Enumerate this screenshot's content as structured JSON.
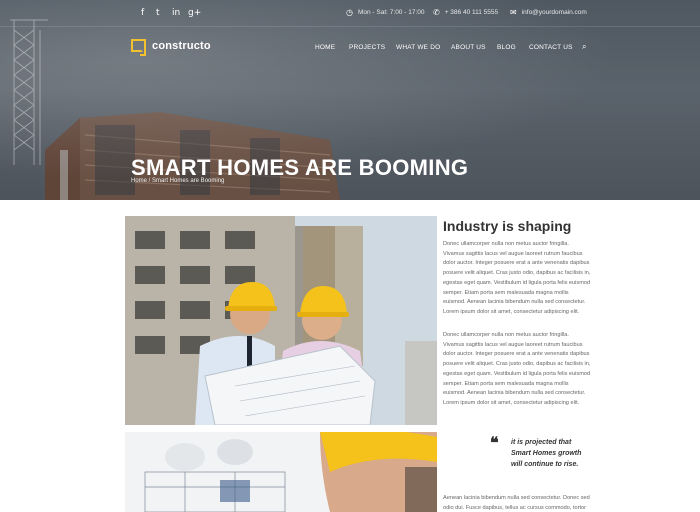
{
  "topbar": {
    "social": [
      "f",
      "t",
      "in",
      "g+"
    ],
    "hours": "Mon - Sat: 7:00 - 17:00",
    "phone": "+ 386 40 111 5555",
    "email": "info@yourdomain.com"
  },
  "brand": {
    "name": "constructo",
    "accent": "#f2c12e"
  },
  "nav": {
    "items": [
      "HOME",
      "PROJECTS",
      "WHAT WE DO",
      "ABOUT US",
      "BLOG",
      "CONTACT US"
    ]
  },
  "hero": {
    "title": "SMART HOMES ARE BOOMING",
    "breadcrumb": "Home / Smart Homes are Booming"
  },
  "article": {
    "heading": "Industry is shaping",
    "paragraph1": "Donec ullamcorper nulla non metus auctor fringilla. Vivamus sagittis lacus vel augue laoreet rutrum faucibus dolor auctor. Integer posuere erat a ante venenatis dapibus posuere velit aliquet. Cras justo odio, dapibus ac facilisis in, egestas eget quam. Vestibulum id ligula porta felis euismod semper. Etiam porta sem malesuada magna mollis euismod. Aenean lacinia bibendum nulla sed consectetur. Lorem ipsum dolor sit amet, consectetur adipiscing elit.",
    "paragraph2": "Donec ullamcorper nulla non metus auctor fringilla. Vivamus sagittis lacus vel augue laoreet rutrum faucibus dolor auctor. Integer posuere erat a ante venenatis dapibus posuere velit aliquet. Cras justo odio, dapibus ac facilisis in, egestas eget quam. Vestibulum id ligula porta felis euismod semper. Etiam porta sem malesuada magna mollis euismod. Aenean lacinia bibendum nulla sed consectetur. Lorem ipsum dolor sit amet, consectetur adipiscing elit.",
    "quote": "it is projected that Smart Homes growth will continue to rise.",
    "paragraph3": "Aenean lacinia bibendum nulla sed consectetur. Donec sed odio dui. Fusce dapibus, tellus ac cursus commodo, tortor"
  }
}
